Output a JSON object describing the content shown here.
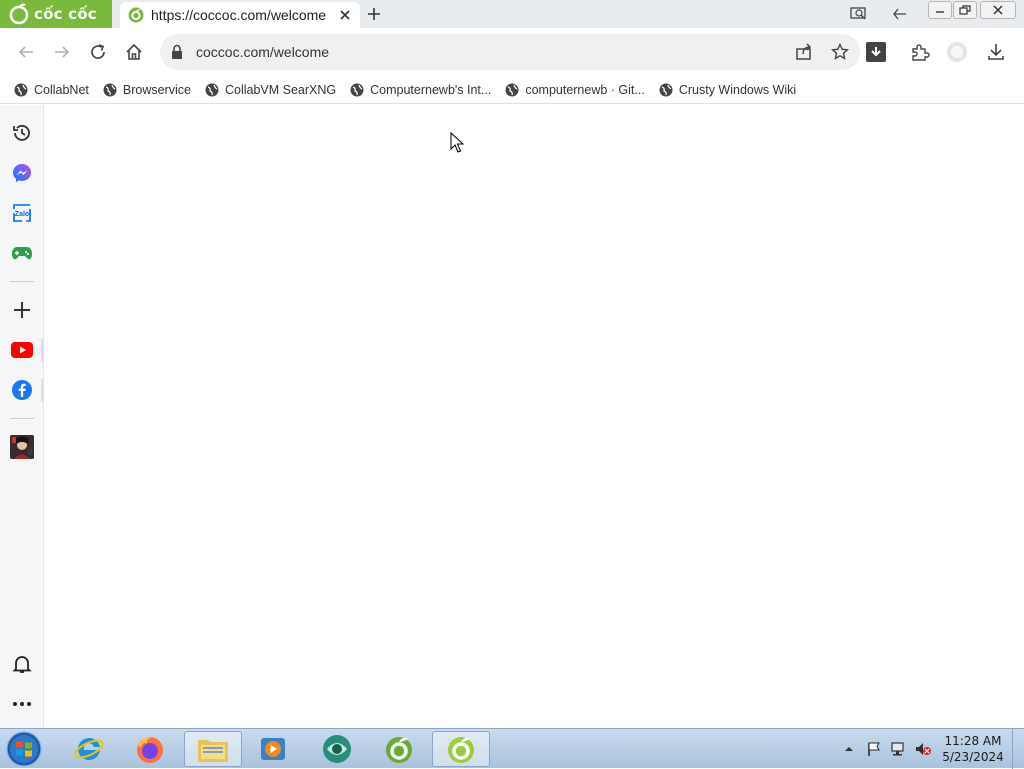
{
  "browser": {
    "brand": "cốc cốc",
    "tab": {
      "title": "https://coccoc.com/welcome",
      "icon": "coccoc-icon"
    },
    "url": "coccoc.com/welcome",
    "accent": "#78b93e"
  },
  "bookmarks": [
    {
      "label": "CollabNet"
    },
    {
      "label": "Browservice"
    },
    {
      "label": "CollabVM SearXNG"
    },
    {
      "label": "Computernewb's Int..."
    },
    {
      "label": "computernewb · Git..."
    },
    {
      "label": "Crusty Windows Wiki"
    }
  ],
  "sidebar": {
    "items": [
      "history-icon",
      "messenger-icon",
      "zalo-icon",
      "gamepad-icon",
      "add-icon",
      "youtube-icon",
      "facebook-icon",
      "game-avatar-icon",
      "bell-icon",
      "more-icon"
    ]
  },
  "taskbar": {
    "apps": [
      "internet-explorer-icon",
      "firefox-icon",
      "file-explorer-icon",
      "media-player-icon",
      "app-icon",
      "coccoc-icon",
      "coccoc-icon"
    ],
    "time": "11:28 AM",
    "date": "5/23/2024"
  }
}
